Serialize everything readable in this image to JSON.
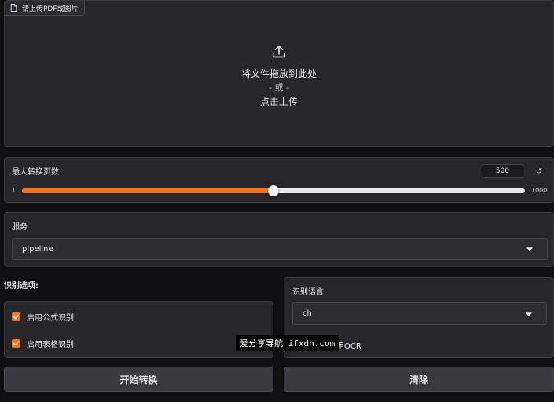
{
  "upload": {
    "label": "请上传PDF或图片",
    "line1": "将文件拖放到此处",
    "or": "- 或 -",
    "line3": "点击上传"
  },
  "slider": {
    "title": "最大转换页数",
    "value": 500,
    "value_text": "500",
    "min": 1,
    "max": 1000,
    "min_text": "1",
    "max_text": "1000",
    "reset_glyph": "↺"
  },
  "service": {
    "title": "服务",
    "selected": "pipeline"
  },
  "options": {
    "heading": "识别选项:",
    "formula_label": "启用公式识别",
    "table_label": "启用表格识别",
    "formula_checked": true,
    "table_checked": true
  },
  "language": {
    "title": "识别语言",
    "selected": "ch",
    "ocr_fragment": "用OCR"
  },
  "watermark": "爱分享导航 ifxdh.com",
  "buttons": {
    "start": "开始转换",
    "clear": "清除"
  },
  "colors": {
    "accent": "#f97316",
    "panel": "#26262b",
    "background": "#0f0f11"
  }
}
